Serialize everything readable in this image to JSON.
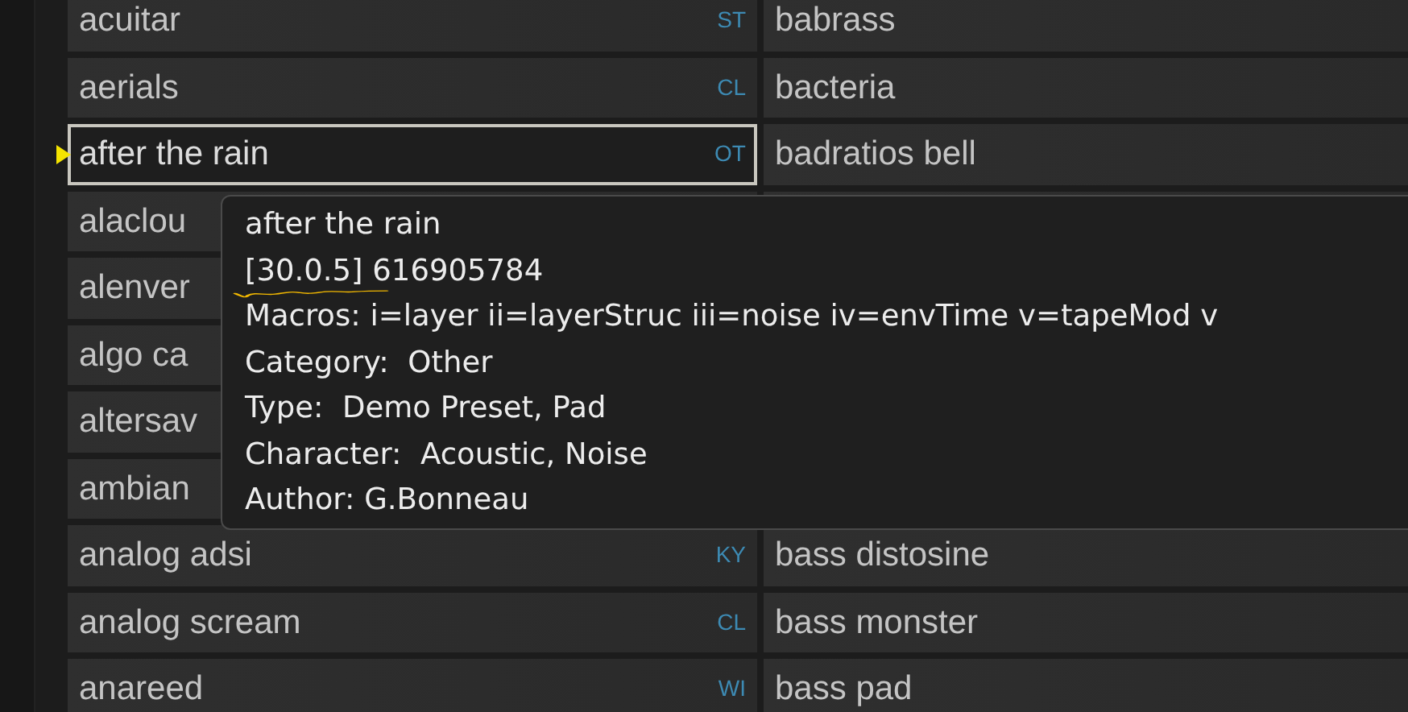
{
  "rows": [
    {
      "left": {
        "name": "acuitar",
        "tag": "ST",
        "selected": false
      },
      "right": {
        "name": "babrass"
      }
    },
    {
      "left": {
        "name": "aerials",
        "tag": "CL",
        "selected": false
      },
      "right": {
        "name": "bacteria"
      }
    },
    {
      "left": {
        "name": "after the rain",
        "tag": "OT",
        "selected": true
      },
      "right": {
        "name": "badratios bell"
      }
    },
    {
      "left": {
        "name": "alaclou",
        "selected": false
      },
      "right": {}
    },
    {
      "left": {
        "name": "alenver",
        "selected": false
      }
    },
    {
      "left": {
        "name": "algo ca",
        "selected": false
      }
    },
    {
      "left": {
        "name": "altersav",
        "selected": false
      }
    },
    {
      "left": {
        "name": "ambian",
        "selected": false
      }
    },
    {
      "left": {
        "name": "analog adsi",
        "tag": "KY",
        "selected": false
      },
      "right": {
        "name": "bass distosine"
      }
    },
    {
      "left": {
        "name": "analog scream",
        "tag": "CL",
        "selected": false
      },
      "right": {
        "name": "bass monster"
      }
    },
    {
      "left": {
        "name": "anareed",
        "tag": "WI",
        "selected": false
      },
      "right": {
        "name": "bass pad"
      }
    }
  ],
  "tooltip": {
    "lines": [
      {
        "text": "after the rain",
        "marked": false
      },
      {
        "text": "[30.0.5] 616905784",
        "marked": true
      },
      {
        "text": "Macros: i=layer ii=layerStruc iii=noise iv=envTime v=tapeMod v",
        "marked": false
      },
      {
        "text": "Category:  Other",
        "marked": false
      },
      {
        "text": "Type:  Demo Preset, Pad",
        "marked": false
      },
      {
        "text": "Character:  Acoustic, Noise",
        "marked": false
      },
      {
        "text": "Author: G.Bonneau",
        "marked": false
      }
    ]
  }
}
